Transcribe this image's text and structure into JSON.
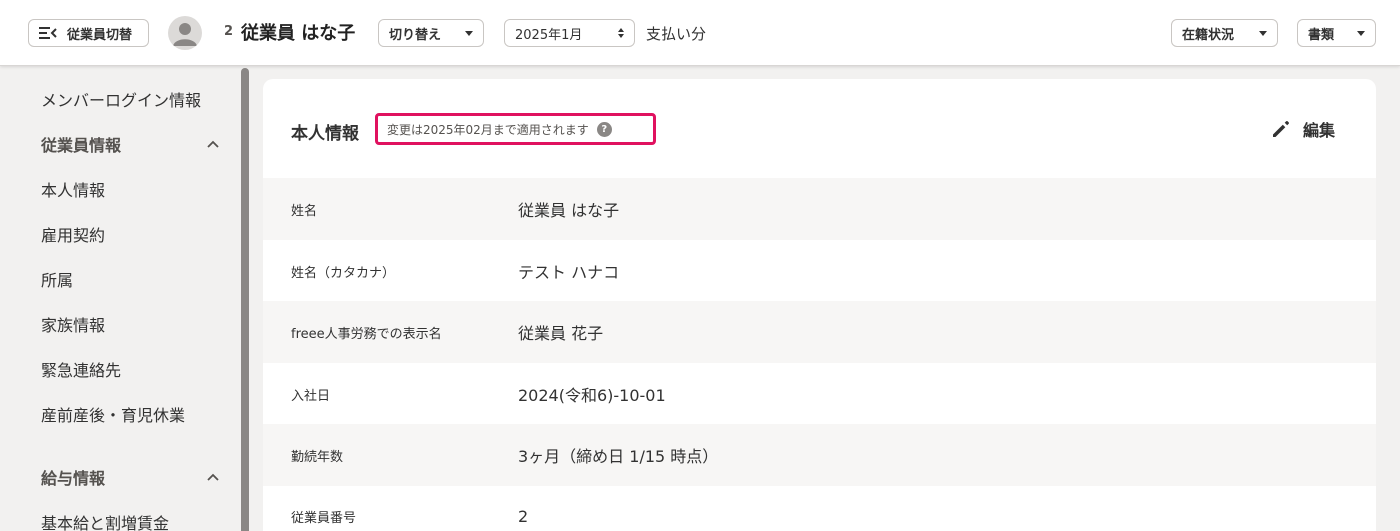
{
  "header": {
    "switch_button": "従業員切替",
    "employee_number": "2",
    "employee_name": "従業員 はな子",
    "switch_dropdown": "切り替え",
    "month_select": "2025年1月",
    "pay_label": "支払い分",
    "status_dropdown": "在籍状況",
    "docs_dropdown": "書類"
  },
  "sidebar": {
    "items": [
      {
        "label": "メンバーログイン情報"
      },
      {
        "label": "従業員情報"
      },
      {
        "label": "本人情報"
      },
      {
        "label": "雇用契約"
      },
      {
        "label": "所属"
      },
      {
        "label": "家族情報"
      },
      {
        "label": "緊急連絡先"
      },
      {
        "label": "産前産後・育児休業"
      },
      {
        "label": "給与情報"
      },
      {
        "label": "基本給と割増賃金"
      }
    ]
  },
  "card": {
    "title": "本人情報",
    "notice": "変更は2025年02月まで適用されます",
    "help_icon": "?",
    "edit_label": "編集",
    "rows": [
      {
        "label": "姓名",
        "value": "従業員 はな子"
      },
      {
        "label": "姓名（カタカナ）",
        "value": "テスト ハナコ"
      },
      {
        "label": "freee人事労務での表示名",
        "value": "従業員 花子"
      },
      {
        "label": "入社日",
        "value": "2024(令和6)-10-01"
      },
      {
        "label": "勤続年数",
        "value": "3ヶ月（締め日 1/15 時点）"
      },
      {
        "label": "従業員番号",
        "value": "2"
      }
    ]
  },
  "colors": {
    "highlight_border": "#e0115f",
    "background": "#f2f1f0",
    "card": "#ffffff"
  }
}
